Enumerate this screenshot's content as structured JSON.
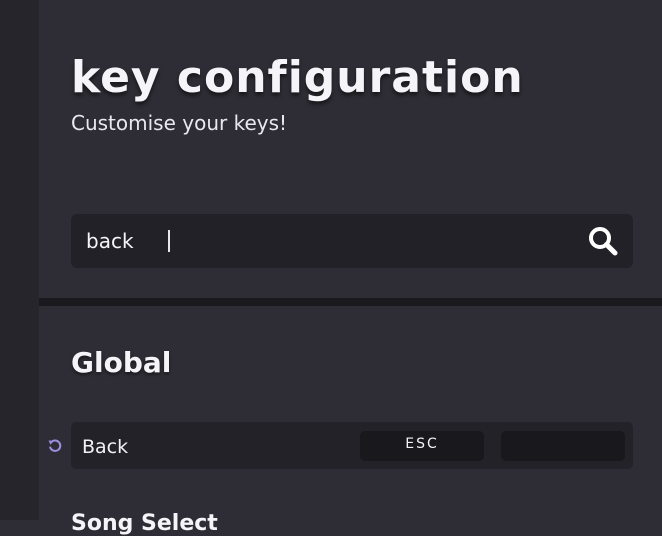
{
  "header": {
    "title": "key configuration",
    "subtitle": "Customise your keys!"
  },
  "search": {
    "value": "back",
    "icon": "search-icon"
  },
  "sections": [
    {
      "title": "Global",
      "rows": [
        {
          "label": "Back",
          "primary_key": "ESC",
          "secondary_key": "",
          "reset_icon": "reset-icon",
          "reset_color": "#9b8fe0"
        }
      ]
    },
    {
      "title": "Song Select"
    }
  ],
  "colors": {
    "background": "#2e2d35",
    "sidebar": "#26252c",
    "input": "#222127",
    "key_binding": "#19181d",
    "accent": "#9b8fe0"
  }
}
